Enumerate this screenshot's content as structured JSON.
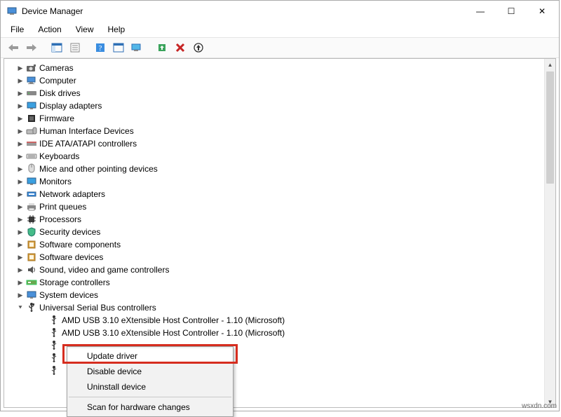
{
  "window": {
    "title": "Device Manager",
    "controls": {
      "minimize": "—",
      "maximize": "☐",
      "close": "✕"
    }
  },
  "menu": {
    "file": "File",
    "action": "Action",
    "view": "View",
    "help": "Help"
  },
  "tree": {
    "items": [
      {
        "icon": "camera",
        "label": "Cameras"
      },
      {
        "icon": "computer",
        "label": "Computer"
      },
      {
        "icon": "disk",
        "label": "Disk drives"
      },
      {
        "icon": "display",
        "label": "Display adapters"
      },
      {
        "icon": "firmware",
        "label": "Firmware"
      },
      {
        "icon": "hid",
        "label": "Human Interface Devices"
      },
      {
        "icon": "ide",
        "label": "IDE ATA/ATAPI controllers"
      },
      {
        "icon": "keyboard",
        "label": "Keyboards"
      },
      {
        "icon": "mouse",
        "label": "Mice and other pointing devices"
      },
      {
        "icon": "monitor",
        "label": "Monitors"
      },
      {
        "icon": "network",
        "label": "Network adapters"
      },
      {
        "icon": "printer",
        "label": "Print queues"
      },
      {
        "icon": "processor",
        "label": "Processors"
      },
      {
        "icon": "security",
        "label": "Security devices"
      },
      {
        "icon": "software",
        "label": "Software components"
      },
      {
        "icon": "software",
        "label": "Software devices"
      },
      {
        "icon": "sound",
        "label": "Sound, video and game controllers"
      },
      {
        "icon": "storage",
        "label": "Storage controllers"
      },
      {
        "icon": "system",
        "label": "System devices"
      }
    ],
    "usb_category": {
      "icon": "usb",
      "label": "Universal Serial Bus controllers"
    },
    "usb_children": [
      {
        "icon": "usb-plug",
        "label": "AMD USB 3.10 eXtensible Host Controller - 1.10 (Microsoft)"
      },
      {
        "icon": "usb-plug",
        "label": "AMD USB 3.10 eXtensible Host Controller - 1.10 (Microsoft)"
      },
      {
        "icon": "usb-plug",
        "label": ""
      },
      {
        "icon": "usb-plug",
        "label": ""
      },
      {
        "icon": "usb-plug",
        "label": ""
      }
    ]
  },
  "context_menu": {
    "update_driver": "Update driver",
    "disable_device": "Disable device",
    "uninstall_device": "Uninstall device",
    "scan": "Scan for hardware changes"
  },
  "watermark": "wsxdn.com"
}
